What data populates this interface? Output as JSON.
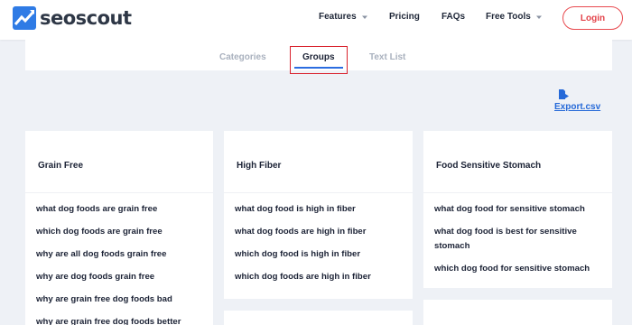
{
  "header": {
    "logo_text": "seoscout",
    "nav": [
      {
        "label": "Features",
        "has_dropdown": true
      },
      {
        "label": "Pricing",
        "has_dropdown": false
      },
      {
        "label": "FAQs",
        "has_dropdown": false
      },
      {
        "label": "Free Tools",
        "has_dropdown": true
      }
    ],
    "login_label": "Login"
  },
  "tabs": [
    {
      "label": "Categories",
      "active": false
    },
    {
      "label": "Groups",
      "active": true
    },
    {
      "label": "Text List",
      "active": false
    }
  ],
  "export": {
    "label": "Export.csv",
    "icon": "file-export-icon"
  },
  "groups": [
    {
      "title": "Grain Free",
      "keywords": [
        "what dog foods are grain free",
        "which dog foods are grain free",
        "why are all dog foods grain free",
        "why are dog foods grain free",
        "why are grain free dog foods bad",
        "why are grain free dog foods better"
      ]
    },
    {
      "title": "High Fiber",
      "keywords": [
        "what dog food is high in fiber",
        "what dog foods are high in fiber",
        "which dog food is high in fiber",
        "which dog foods are high in fiber"
      ]
    },
    {
      "title": "Food Sensitive Stomach",
      "keywords": [
        "what dog food for sensitive stomach",
        "what dog food is best for sensitive stomach",
        "which dog food for sensitive stomach"
      ]
    }
  ],
  "colors": {
    "accent": "#2b6de0",
    "login": "#e3434a",
    "highlight": "#d9232e",
    "background": "#eef1f6"
  }
}
